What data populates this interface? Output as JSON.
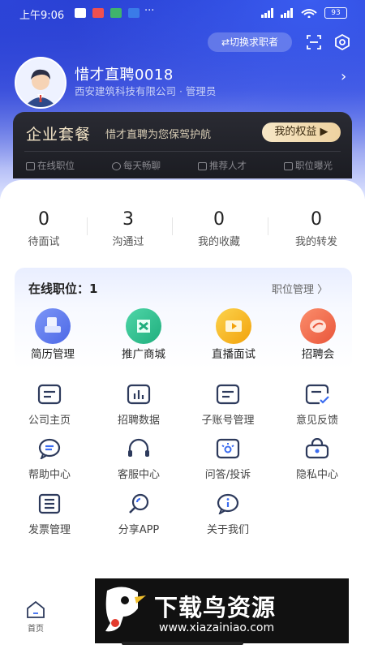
{
  "status_bar": {
    "time": "上午9:06",
    "dots": "···",
    "battery": "93"
  },
  "header": {
    "switch_label": "切换求职者",
    "company_name": "惜才直聘0018",
    "company_sub": "西安建筑科技有限公司 · 管理员"
  },
  "vip": {
    "title": "企业套餐",
    "slogan": "惜才直聘为您保驾护航",
    "button": "我的权益 ▶",
    "features": [
      "在线职位",
      "每天畅聊",
      "推荐人才",
      "职位曝光"
    ]
  },
  "stats": [
    {
      "value": "0",
      "label": "待面试"
    },
    {
      "value": "3",
      "label": "沟通过"
    },
    {
      "value": "0",
      "label": "我的收藏"
    },
    {
      "value": "0",
      "label": "我的转发"
    }
  ],
  "jobs": {
    "title": "在线职位：1",
    "manage": "职位管理 〉",
    "items": [
      {
        "label": "简历管理",
        "color": "#5b7bf0"
      },
      {
        "label": "推广商城",
        "color": "#2fbf8f"
      },
      {
        "label": "直播面试",
        "color": "#f5b51c"
      },
      {
        "label": "招聘会",
        "color": "#f26b4a"
      }
    ]
  },
  "grid": [
    {
      "label": "公司主页",
      "icon": "company-icon"
    },
    {
      "label": "招聘数据",
      "icon": "chart-icon"
    },
    {
      "label": "子账号管理",
      "icon": "subaccount-icon"
    },
    {
      "label": "意见反馈",
      "icon": "feedback-icon"
    },
    {
      "label": "帮助中心",
      "icon": "help-icon"
    },
    {
      "label": "客服中心",
      "icon": "headset-icon"
    },
    {
      "label": "问答/投诉",
      "icon": "qa-icon"
    },
    {
      "label": "隐私中心",
      "icon": "privacy-icon"
    },
    {
      "label": "发票管理",
      "icon": "invoice-icon"
    },
    {
      "label": "分享APP",
      "icon": "share-icon"
    },
    {
      "label": "关于我们",
      "icon": "about-icon"
    }
  ],
  "tabbar": {
    "home": "首页"
  },
  "ad": {
    "title": "下载鸟资源",
    "url": "www.xiazainiao.com"
  },
  "colors": {
    "brand_blue": "#2337c9",
    "vip_gold": "#f5e6c8",
    "icon_navy": "#2d3a5c"
  }
}
